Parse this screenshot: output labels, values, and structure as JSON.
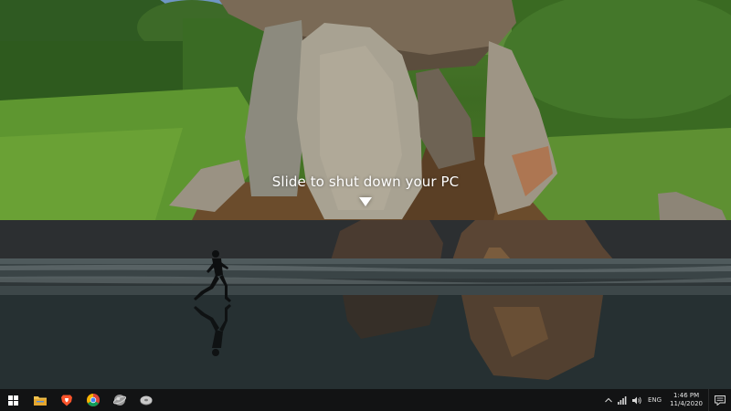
{
  "shutdown_overlay": {
    "message": "Slide to shut down your PC",
    "arrow_icon": "down-triangle-icon"
  },
  "taskbar": {
    "pinned": [
      {
        "name": "start-button",
        "icon": "windows-logo-icon"
      },
      {
        "name": "file-explorer-button",
        "icon": "folder-icon"
      },
      {
        "name": "brave-browser-button",
        "icon": "brave-lion-icon"
      },
      {
        "name": "chrome-browser-button",
        "icon": "chrome-icon"
      },
      {
        "name": "app-button-1",
        "icon": "app-orb-icon"
      },
      {
        "name": "app-button-2",
        "icon": "app-disc-icon"
      }
    ],
    "tray": {
      "language": "ENG",
      "time": "1:46 PM",
      "date": "11/4/2020"
    }
  },
  "colors": {
    "taskbar_bg": "#121314",
    "text_white": "#ffffff",
    "chrome_red": "#db4437",
    "chrome_green": "#0f9d58",
    "chrome_yellow": "#f4b400",
    "chrome_blue": "#4285f4",
    "brave_orange": "#fb542b",
    "folder_yellow": "#f3c34d"
  }
}
